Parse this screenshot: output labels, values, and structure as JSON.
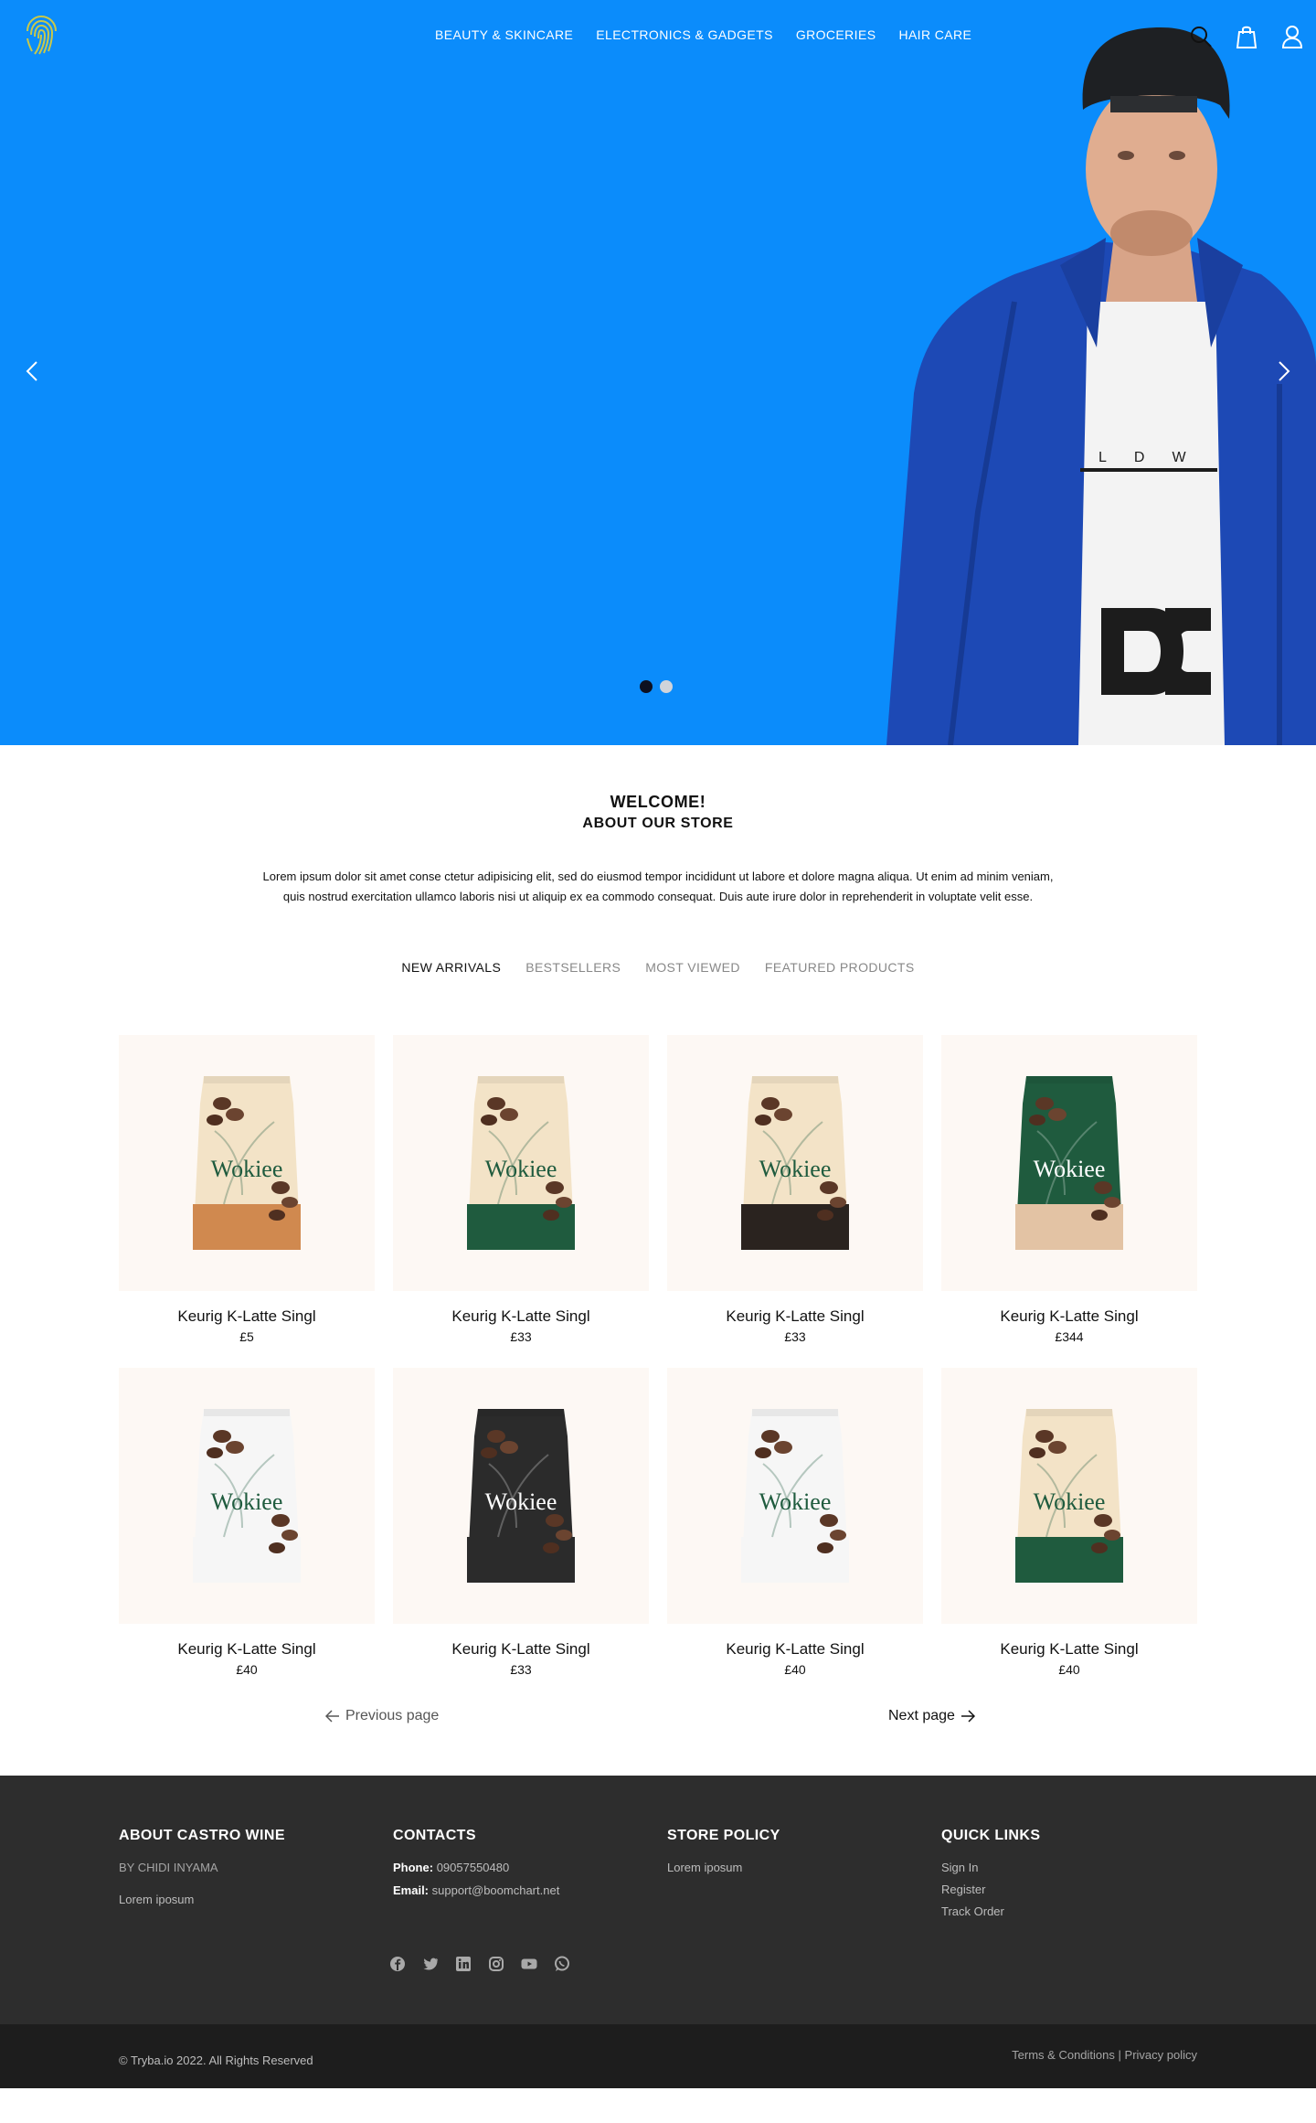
{
  "header": {
    "nav": [
      "BEAUTY & SKINCARE",
      "ELECTRONICS & GADGETS",
      "GROCERIES",
      "HAIR CARE"
    ],
    "icons": [
      "search-icon",
      "cart-icon",
      "user-icon"
    ],
    "hero_bg": "#0b8cfb",
    "slides": 2,
    "active_slide": 1
  },
  "welcome": {
    "title": "WELCOME!",
    "subtitle": "ABOUT OUR STORE",
    "body": "Lorem ipsum dolor sit amet conse ctetur adipisicing elit, sed do eiusmod tempor incididunt ut labore et dolore magna aliqua. Ut enim ad minim veniam, quis nostrud exercitation ullamco laboris nisi ut aliquip ex ea commodo consequat. Duis aute irure dolor in reprehenderit in voluptate velit esse."
  },
  "tabs": [
    {
      "label": "NEW ARRIVALS",
      "active": true
    },
    {
      "label": "BESTSELLERS",
      "active": false
    },
    {
      "label": "MOST VIEWED",
      "active": false
    },
    {
      "label": "FEATURED PRODUCTS",
      "active": false
    }
  ],
  "products": [
    {
      "name": "Keurig K-Latte Singl",
      "price": "£5",
      "bag_color": "#f3e3c7",
      "band_color": "#d0894f",
      "brand": "Wokiee"
    },
    {
      "name": "Keurig K-Latte Singl",
      "price": "£33",
      "bag_color": "#f3e3c7",
      "band_color": "#1f5b3e",
      "brand": "Wokiee"
    },
    {
      "name": "Keurig K-Latte Singl",
      "price": "£33",
      "bag_color": "#f3e3c7",
      "band_color": "#2a231f",
      "brand": "Wokiee"
    },
    {
      "name": "Keurig K-Latte Singl",
      "price": "£344",
      "bag_color": "#1f5b3e",
      "band_color": "#e3c3a4",
      "brand": "Wokiee"
    },
    {
      "name": "Keurig K-Latte Singl",
      "price": "£40",
      "bag_color": "#f6f6f6",
      "band_color": "#f6f6f6",
      "brand": "Wokiee"
    },
    {
      "name": "Keurig K-Latte Singl",
      "price": "£33",
      "bag_color": "#2b2b2b",
      "band_color": "#2b2b2b",
      "brand": "Wokiee"
    },
    {
      "name": "Keurig K-Latte Singl",
      "price": "£40",
      "bag_color": "#f6f6f6",
      "band_color": "#f6f6f6",
      "brand": "Wokiee"
    },
    {
      "name": "Keurig K-Latte Singl",
      "price": "£40",
      "bag_color": "#f3e3c7",
      "band_color": "#1f5b3e",
      "brand": "Wokiee"
    }
  ],
  "pager": {
    "prev": "Previous page",
    "next": "Next page"
  },
  "footer": {
    "about_title": "ABOUT CASTRO WINE",
    "about_by": "BY CHIDI INYAMA",
    "about_text": "Lorem iposum",
    "contacts_title": "CONTACTS",
    "phone_label": "Phone:",
    "phone": "09057550480",
    "email_label": "Email:",
    "email": "support@boomchart.net",
    "policy_title": "STORE POLICY",
    "policy_text": "Lorem iposum",
    "links_title": "QUICK LINKS",
    "links": [
      "Sign In",
      "Register",
      "Track Order"
    ],
    "socials": [
      "facebook-icon",
      "twitter-icon",
      "linkedin-icon",
      "instagram-icon",
      "youtube-icon",
      "whatsapp-icon"
    ],
    "copyright": "© Tryba.io 2022. All Rights Reserved",
    "terms": "Terms & Conditions",
    "separator": "|",
    "privacy": "Privacy policy"
  }
}
